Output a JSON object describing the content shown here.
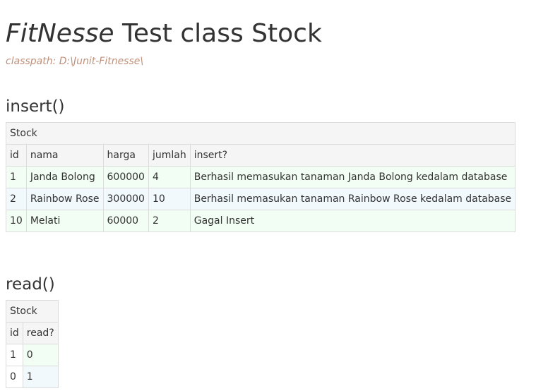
{
  "header": {
    "brand": "FitNesse",
    "title_rest": "Test class Stock",
    "classpath": "classpath: D:\\Junit-Fitnesse\\"
  },
  "insert_section": {
    "heading": "insert()",
    "fixture_name": "Stock",
    "columns": [
      "id",
      "nama",
      "harga",
      "jumlah",
      "insert?"
    ],
    "rows": [
      [
        "1",
        "Janda Bolong",
        "600000",
        "4",
        "Berhasil memasukan tanaman Janda Bolong kedalam database"
      ],
      [
        "2",
        "Rainbow Rose",
        "300000",
        "10",
        "Berhasil memasukan tanaman Rainbow Rose kedalam database"
      ],
      [
        "10",
        "Melati",
        "60000",
        "2",
        "Gagal Insert"
      ]
    ]
  },
  "read_section": {
    "heading": "read()",
    "fixture_name": "Stock",
    "columns": [
      "id",
      "read?"
    ],
    "rows": [
      [
        "1",
        "0"
      ],
      [
        "0",
        "1"
      ]
    ]
  },
  "colors": {
    "pass_row": "#f2fdf3",
    "ignore_row": "#f1f9fd",
    "header_bg": "#f5f5f5",
    "classpath_text": "#c0907a"
  }
}
